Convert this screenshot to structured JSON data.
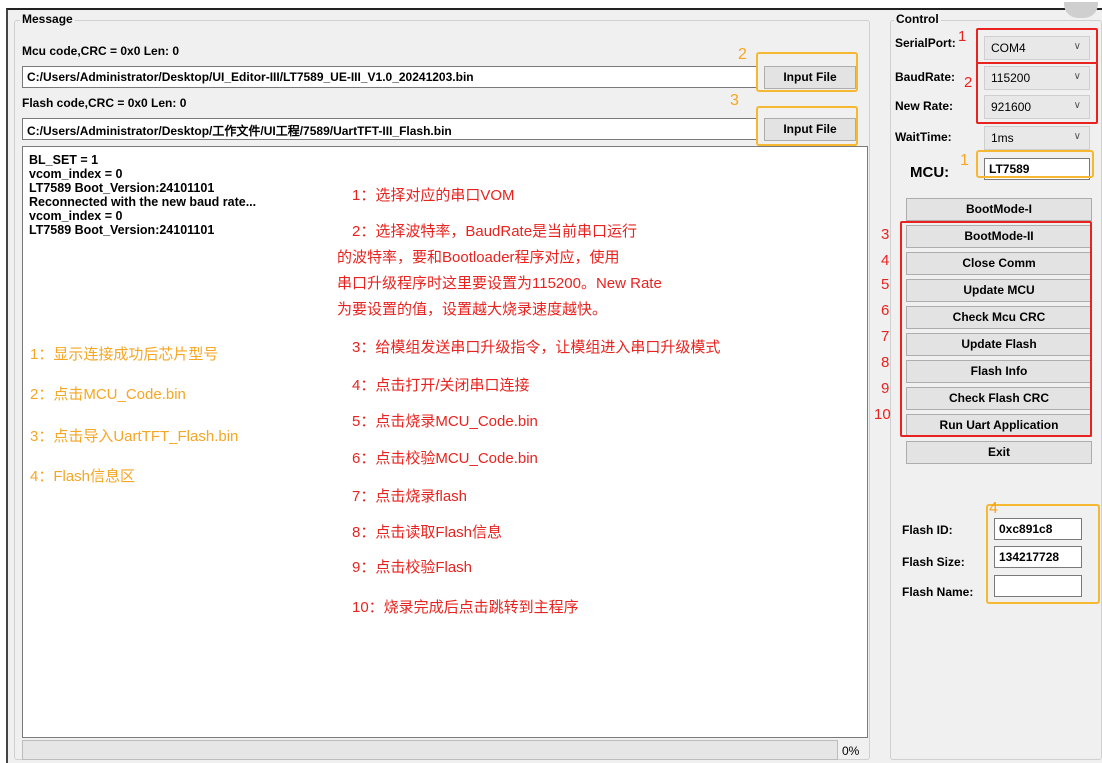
{
  "message_group": {
    "title": "Message",
    "mcu_code_label": "Mcu code,CRC = 0x0  Len: 0",
    "mcu_path": "C:/Users/Administrator/Desktop/UI_Editor-III/LT7589_UE-III_V1.0_20241203.bin",
    "flash_code_label": "Flash code,CRC = 0x0  Len: 0",
    "flash_path": "C:/Users/Administrator/Desktop/工作文件/UI工程/7589/UartTFT-III_Flash.bin",
    "input_file_label": "Input File",
    "log_lines": [
      "BL_SET = 1",
      "vcom_index = 0",
      "LT7589 Boot_Version:24101101",
      "Reconnected with the new baud rate...",
      "vcom_index = 0",
      "LT7589 Boot_Version:24101101"
    ],
    "progress_percent": 0,
    "progress_text": "0%"
  },
  "control_group": {
    "title": "Control",
    "serial_port_label": "SerialPort:",
    "serial_port_value": "COM4",
    "baud_rate_label": "BaudRate:",
    "baud_rate_value": "115200",
    "new_rate_label": "New Rate:",
    "new_rate_value": "921600",
    "wait_time_label": "WaitTime:",
    "wait_time_value": "1ms",
    "mcu_label": "MCU:",
    "mcu_value": "LT7589",
    "buttons": [
      "BootMode-I",
      "BootMode-II",
      "Close Comm",
      "Update MCU",
      "Check Mcu CRC",
      "Update Flash",
      "Flash Info",
      "Check Flash CRC",
      "Run Uart Application",
      "Exit"
    ],
    "flash_id_label": "Flash ID:",
    "flash_id_value": "0xc891c8",
    "flash_size_label": "Flash Size:",
    "flash_size_value": "134217728",
    "flash_name_label": "Flash Name:",
    "flash_name_value": ""
  },
  "annotations": {
    "red_notes": [
      "1：选择对应的串口VOM",
      "2：选择波特率，BaudRate是当前串口运行",
      "的波特率，要和Bootloader程序对应，使用",
      "串口升级程序时这里要设置为115200。New Rate",
      "为要设置的值，设置越大烧录速度越快。",
      "3：给模组发送串口升级指令，让模组进入串口升级模式",
      "4：点击打开/关闭串口连接",
      "5：点击烧录MCU_Code.bin",
      "6：点击校验MCU_Code.bin",
      "7：点击烧录flash",
      "8：点击读取Flash信息",
      "9：点击校验Flash",
      "10：烧录完成后点击跳转到主程序"
    ],
    "yellow_notes": [
      "1：显示连接成功后芯片型号",
      "2：点击MCU_Code.bin",
      "3：点击导入UartTFT_Flash.bin",
      "4：Flash信息区"
    ],
    "markers": {
      "serial": "1",
      "baud": "2",
      "mcu": "1",
      "input1": "2",
      "input2": "3",
      "btn3": "3",
      "btn4": "4",
      "btn5": "5",
      "btn6": "6",
      "btn7": "7",
      "btn8": "8",
      "btn9": "9",
      "btn10": "10",
      "flash": "4"
    },
    "colors": {
      "red": "#e8231f",
      "yellow": "#f5a623"
    }
  }
}
